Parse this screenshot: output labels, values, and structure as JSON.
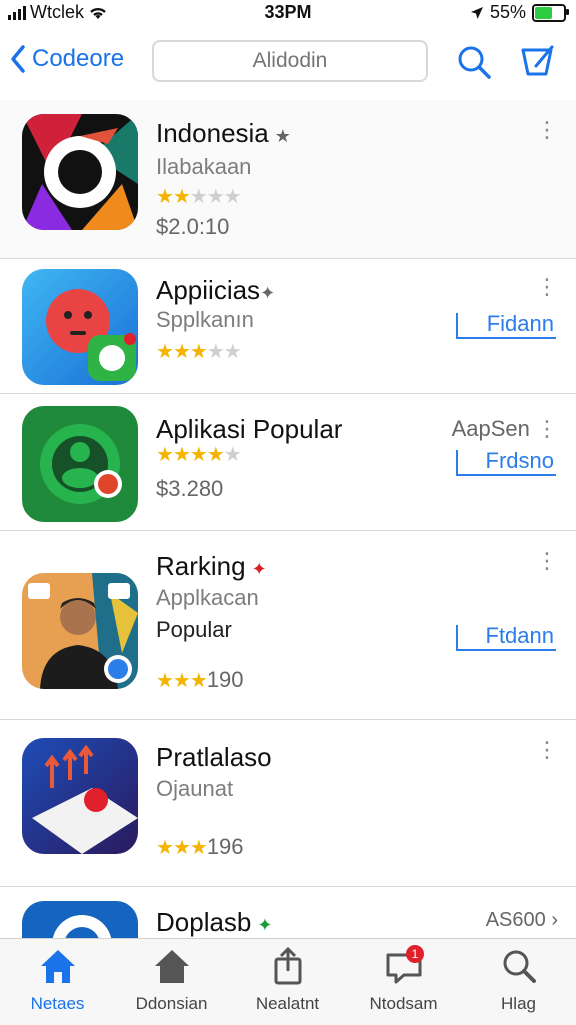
{
  "status_bar": {
    "carrier": "Wtclek",
    "time": "33PM",
    "battery": "55%",
    "battery_level": 0.55
  },
  "nav": {
    "back_label": "Codeore",
    "search_placeholder": "Alidodin"
  },
  "apps": [
    {
      "title": "Indonesia",
      "subtitle": "Ilabakaan",
      "rating": 2.5,
      "price": "$2.0:10"
    },
    {
      "title": "Appiicias",
      "subtitle": "Spplkanın",
      "rating": 3.5,
      "button": "Fidann"
    },
    {
      "title": "Aplikasi Popular",
      "right_label": "AapSen",
      "rating": 4,
      "button": "Frdsno",
      "price": "$3.280"
    },
    {
      "title": "Rarking",
      "subtitle": "Applkacan",
      "subtitle2": "Popular",
      "rating": 3,
      "rating_text": "190",
      "button": "Ftdann"
    },
    {
      "title": "Pratlalaso",
      "subtitle": "Ojaunat",
      "rating": 3,
      "rating_text": "196"
    },
    {
      "title": "Doplasb",
      "right_label": "AS600"
    }
  ],
  "tabs": [
    {
      "label": "Netaes",
      "icon": "home-icon"
    },
    {
      "label": "Ddonsian",
      "icon": "house-icon"
    },
    {
      "label": "Nealatnt",
      "icon": "share-icon"
    },
    {
      "label": "Ntodsam",
      "icon": "message-icon",
      "badge": "1"
    },
    {
      "label": "Hlag",
      "icon": "search-icon"
    }
  ],
  "colors": {
    "accent": "#1a73e8",
    "star": "#f5b400",
    "badge": "#e0202b"
  }
}
